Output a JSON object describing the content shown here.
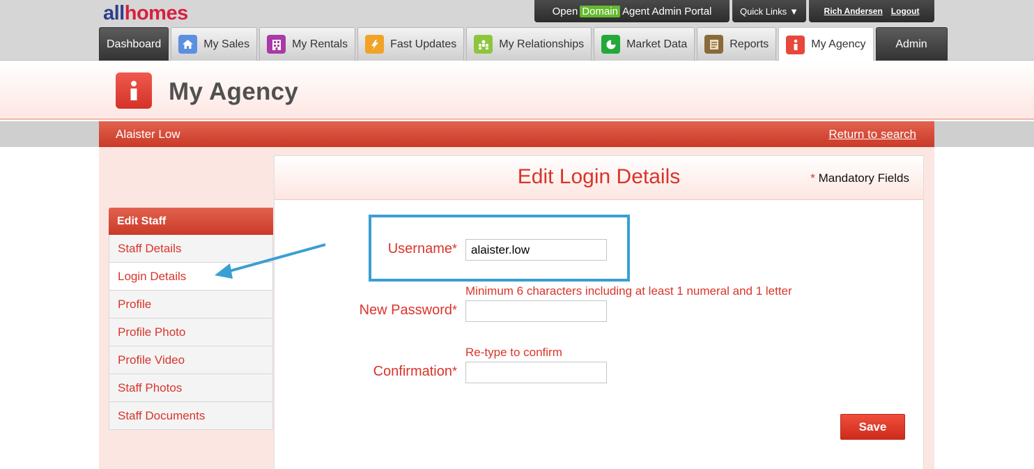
{
  "logo": {
    "part1": "all",
    "part2": "homes"
  },
  "top": {
    "portal_open": "Open",
    "portal_domain": "Domain",
    "portal_rest": "Agent Admin Portal",
    "quick_links": "Quick Links",
    "quick_links_caret": "▼",
    "user_name": "Rich Andersen",
    "logout": "Logout"
  },
  "tabs": [
    {
      "label": "Dashboard",
      "icon": "none",
      "color": "#333333"
    },
    {
      "label": "My Sales",
      "icon": "house-icon",
      "color": "#5b8fe0"
    },
    {
      "label": "My Rentals",
      "icon": "building-icon",
      "color": "#a93aa6"
    },
    {
      "label": "Fast Updates",
      "icon": "lightning-icon",
      "color": "#f0a327"
    },
    {
      "label": "My Relationships",
      "icon": "people-icon",
      "color": "#8cc63e"
    },
    {
      "label": "Market Data",
      "icon": "pie-chart-icon",
      "color": "#24a83a"
    },
    {
      "label": "Reports",
      "icon": "document-icon",
      "color": "#8a6a3a"
    },
    {
      "label": "My Agency",
      "icon": "info-person-icon",
      "color": "#e8473c"
    },
    {
      "label": "Admin",
      "icon": "none",
      "color": "#333333"
    }
  ],
  "page": {
    "title": "My Agency"
  },
  "subheader": {
    "staff_name": "Alaister Low",
    "return_link": "Return to search"
  },
  "sidebar": {
    "heading": "Edit Staff",
    "items": [
      {
        "label": "Staff Details"
      },
      {
        "label": "Login Details"
      },
      {
        "label": "Profile"
      },
      {
        "label": "Profile Photo"
      },
      {
        "label": "Profile Video"
      },
      {
        "label": "Staff Photos"
      },
      {
        "label": "Staff Documents"
      }
    ]
  },
  "form": {
    "title": "Edit Login Details",
    "mandatory_star": "*",
    "mandatory_text": "Mandatory Fields",
    "username_label": "Username",
    "username_value": "alaister.low",
    "password_hint": "Minimum 6 characters including at least 1 numeral and 1 letter",
    "password_label": "New Password",
    "confirm_hint": "Re-type to confirm",
    "confirm_label": "Confirmation",
    "required_star": "*",
    "save_label": "Save"
  },
  "colors": {
    "accent": "#d9342a",
    "highlight": "#3a9fd2"
  }
}
